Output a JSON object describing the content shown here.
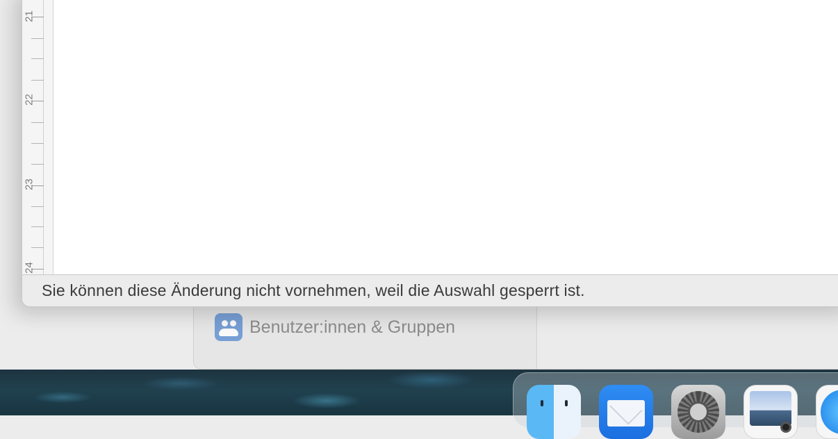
{
  "document": {
    "ruler": {
      "labels": [
        "21",
        "22",
        "23",
        "24"
      ]
    },
    "status_message": "Sie können diese Änderung nicht vornehmen, weil die Auswahl gesperrt ist."
  },
  "settings": {
    "sidebar": {
      "items": [
        {
          "label": "Benutzer:innen & Gruppen",
          "icon": "users-groups-icon"
        }
      ]
    }
  },
  "dock": {
    "apps": [
      {
        "icon": "finder-icon"
      },
      {
        "icon": "mail-icon"
      },
      {
        "icon": "system-settings-icon"
      },
      {
        "icon": "preview-icon"
      },
      {
        "icon": "safari-icon"
      }
    ]
  }
}
